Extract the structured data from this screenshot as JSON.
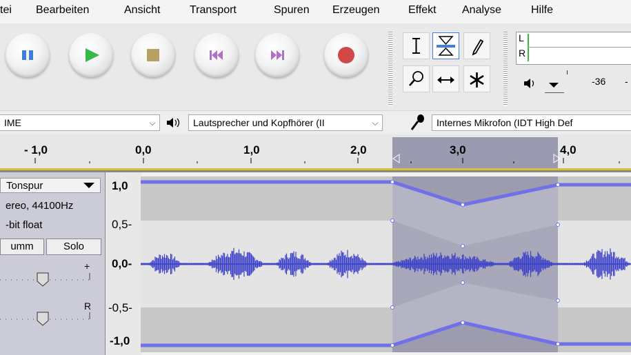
{
  "menu": {
    "items": [
      "tei",
      "Bearbeiten",
      "Ansicht",
      "Transport",
      "Spuren",
      "Erzeugen",
      "Effekt",
      "Analyse",
      "Hilfe"
    ]
  },
  "transport": {
    "buttons": [
      {
        "name": "pause",
        "color": "#3e7fd8"
      },
      {
        "name": "play",
        "color": "#38b848"
      },
      {
        "name": "stop",
        "color": "#b8a064"
      },
      {
        "name": "skip-to-start",
        "color": "#b070c8"
      },
      {
        "name": "skip-to-end",
        "color": "#b070c8"
      },
      {
        "name": "record",
        "color": "#d04848"
      }
    ]
  },
  "tools": {
    "selected": "envelope-tool",
    "items": [
      "selection-tool",
      "envelope-tool",
      "draw-tool",
      "zoom-tool",
      "timeshift-tool",
      "multi-tool"
    ]
  },
  "meter": {
    "channel_left": "L",
    "channel_right": "R",
    "db_label_1": "-36",
    "db_label_2": "-"
  },
  "devices": {
    "host_value": "IME",
    "playback_value": "Lautsprecher und Kopfhörer (II",
    "recording_value": "Internes Mikrofon (IDT High Def"
  },
  "ruler": {
    "labels": [
      "- 1,0",
      "0,0",
      "1,0",
      "2,0",
      "3,0",
      "4,0"
    ]
  },
  "track": {
    "name": "Tonspur",
    "info_line1": "ereo, 44100Hz",
    "info_line2": "-bit float",
    "mute_label": "umm",
    "solo_label": "Solo",
    "gain_plus": "+",
    "pan_r": "R",
    "vruler_labels": [
      "1,0",
      "0,5-",
      "0,0-",
      "-0,5-",
      "-1,0"
    ]
  },
  "colors": {
    "waveform": "#3a3fc8",
    "envelope": "#7070e8",
    "selection_bg": "#9c9cae",
    "track_bg": "#c8c8c8",
    "track_light": "#e4e4e4"
  }
}
